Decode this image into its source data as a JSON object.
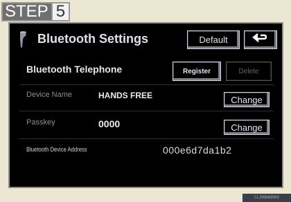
{
  "step": {
    "label": "STEP",
    "number": "5"
  },
  "header": {
    "title": "Bluetooth Settings",
    "default_label": "Default"
  },
  "telephone": {
    "label": "Bluetooth Telephone",
    "register_label": "Register",
    "delete_label": "Delete"
  },
  "device_name": {
    "label": "Device Name",
    "value": "HANDS FREE",
    "change_label": "Change"
  },
  "passkey": {
    "label": "Passkey",
    "value": "0000",
    "change_label": "Change"
  },
  "address": {
    "label": "Bluetooth Device Address",
    "value": "000e6d7da1b2"
  },
  "footer_code": "CL30BAH006"
}
